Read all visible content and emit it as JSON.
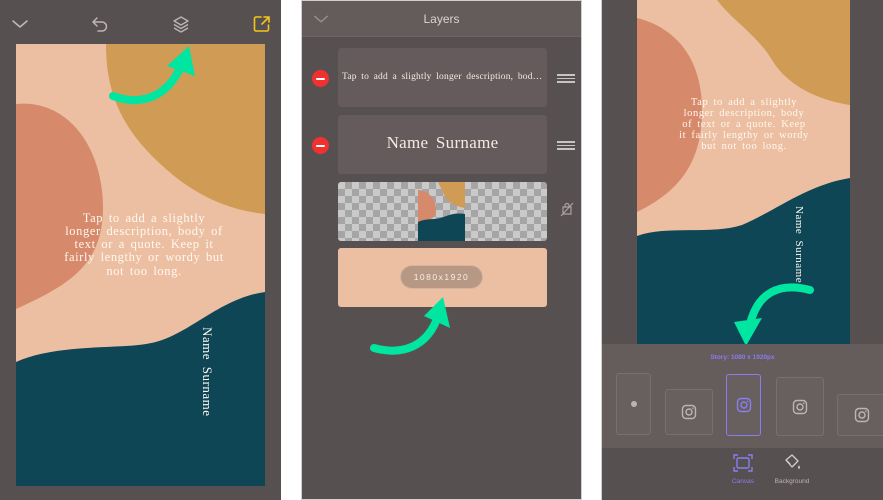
{
  "colors": {
    "frame_bg": "#575050",
    "accent_green": "#00e5a0",
    "accent_yellow": "#f5c518",
    "accent_purple": "#8a7df0",
    "remove_red": "#f0312f",
    "canvas_peach": "#ecbfa2",
    "canvas_mustard": "#d09b55",
    "canvas_terracotta": "#d6896b",
    "canvas_teal": "#0f4655"
  },
  "editor": {
    "toolbar": {
      "collapse_icon": "chevron-down-icon",
      "undo_icon": "undo-icon",
      "layers_icon": "layers-icon",
      "export_icon": "share-export-icon"
    },
    "canvas": {
      "description": "Tap to add a slightly longer description, body of text or a quote. Keep it fairly lengthy or wordy but not too long.",
      "name": "Name Surname"
    }
  },
  "layers_panel": {
    "title": "Layers",
    "collapse_icon": "chevron-down-icon",
    "layers": [
      {
        "type": "text",
        "label": "Tap to add a slightly longer description, body of tex…",
        "removable": true,
        "draggable": true
      },
      {
        "type": "text",
        "label": "Name Surname",
        "removable": true,
        "draggable": true
      },
      {
        "type": "image",
        "label": "",
        "removable": false,
        "locked_icon": "hidden-lock-icon"
      },
      {
        "type": "background",
        "label": "1080x1920",
        "removable": false
      }
    ]
  },
  "canvas_panel": {
    "canvas": {
      "description": "Tap to add a slightly longer description, body of text or a quote. Keep it fairly lengthy or wordy but not too long.",
      "name": "Name Surname"
    },
    "size_label": "Story: 1080 x 1920px",
    "formats": [
      {
        "name": "custom",
        "icon": "dot-icon",
        "active": false
      },
      {
        "name": "instagram-post",
        "icon": "instagram-icon",
        "active": false
      },
      {
        "name": "instagram-story",
        "icon": "instagram-icon",
        "active": true
      },
      {
        "name": "instagram-portrait",
        "icon": "instagram-icon",
        "active": false
      },
      {
        "name": "instagram-landscape",
        "icon": "instagram-icon",
        "active": false
      }
    ],
    "tabs": [
      {
        "label": "Canvas",
        "icon": "canvas-frame-icon",
        "active": true
      },
      {
        "label": "Background",
        "icon": "paint-bucket-icon",
        "active": false
      }
    ]
  }
}
